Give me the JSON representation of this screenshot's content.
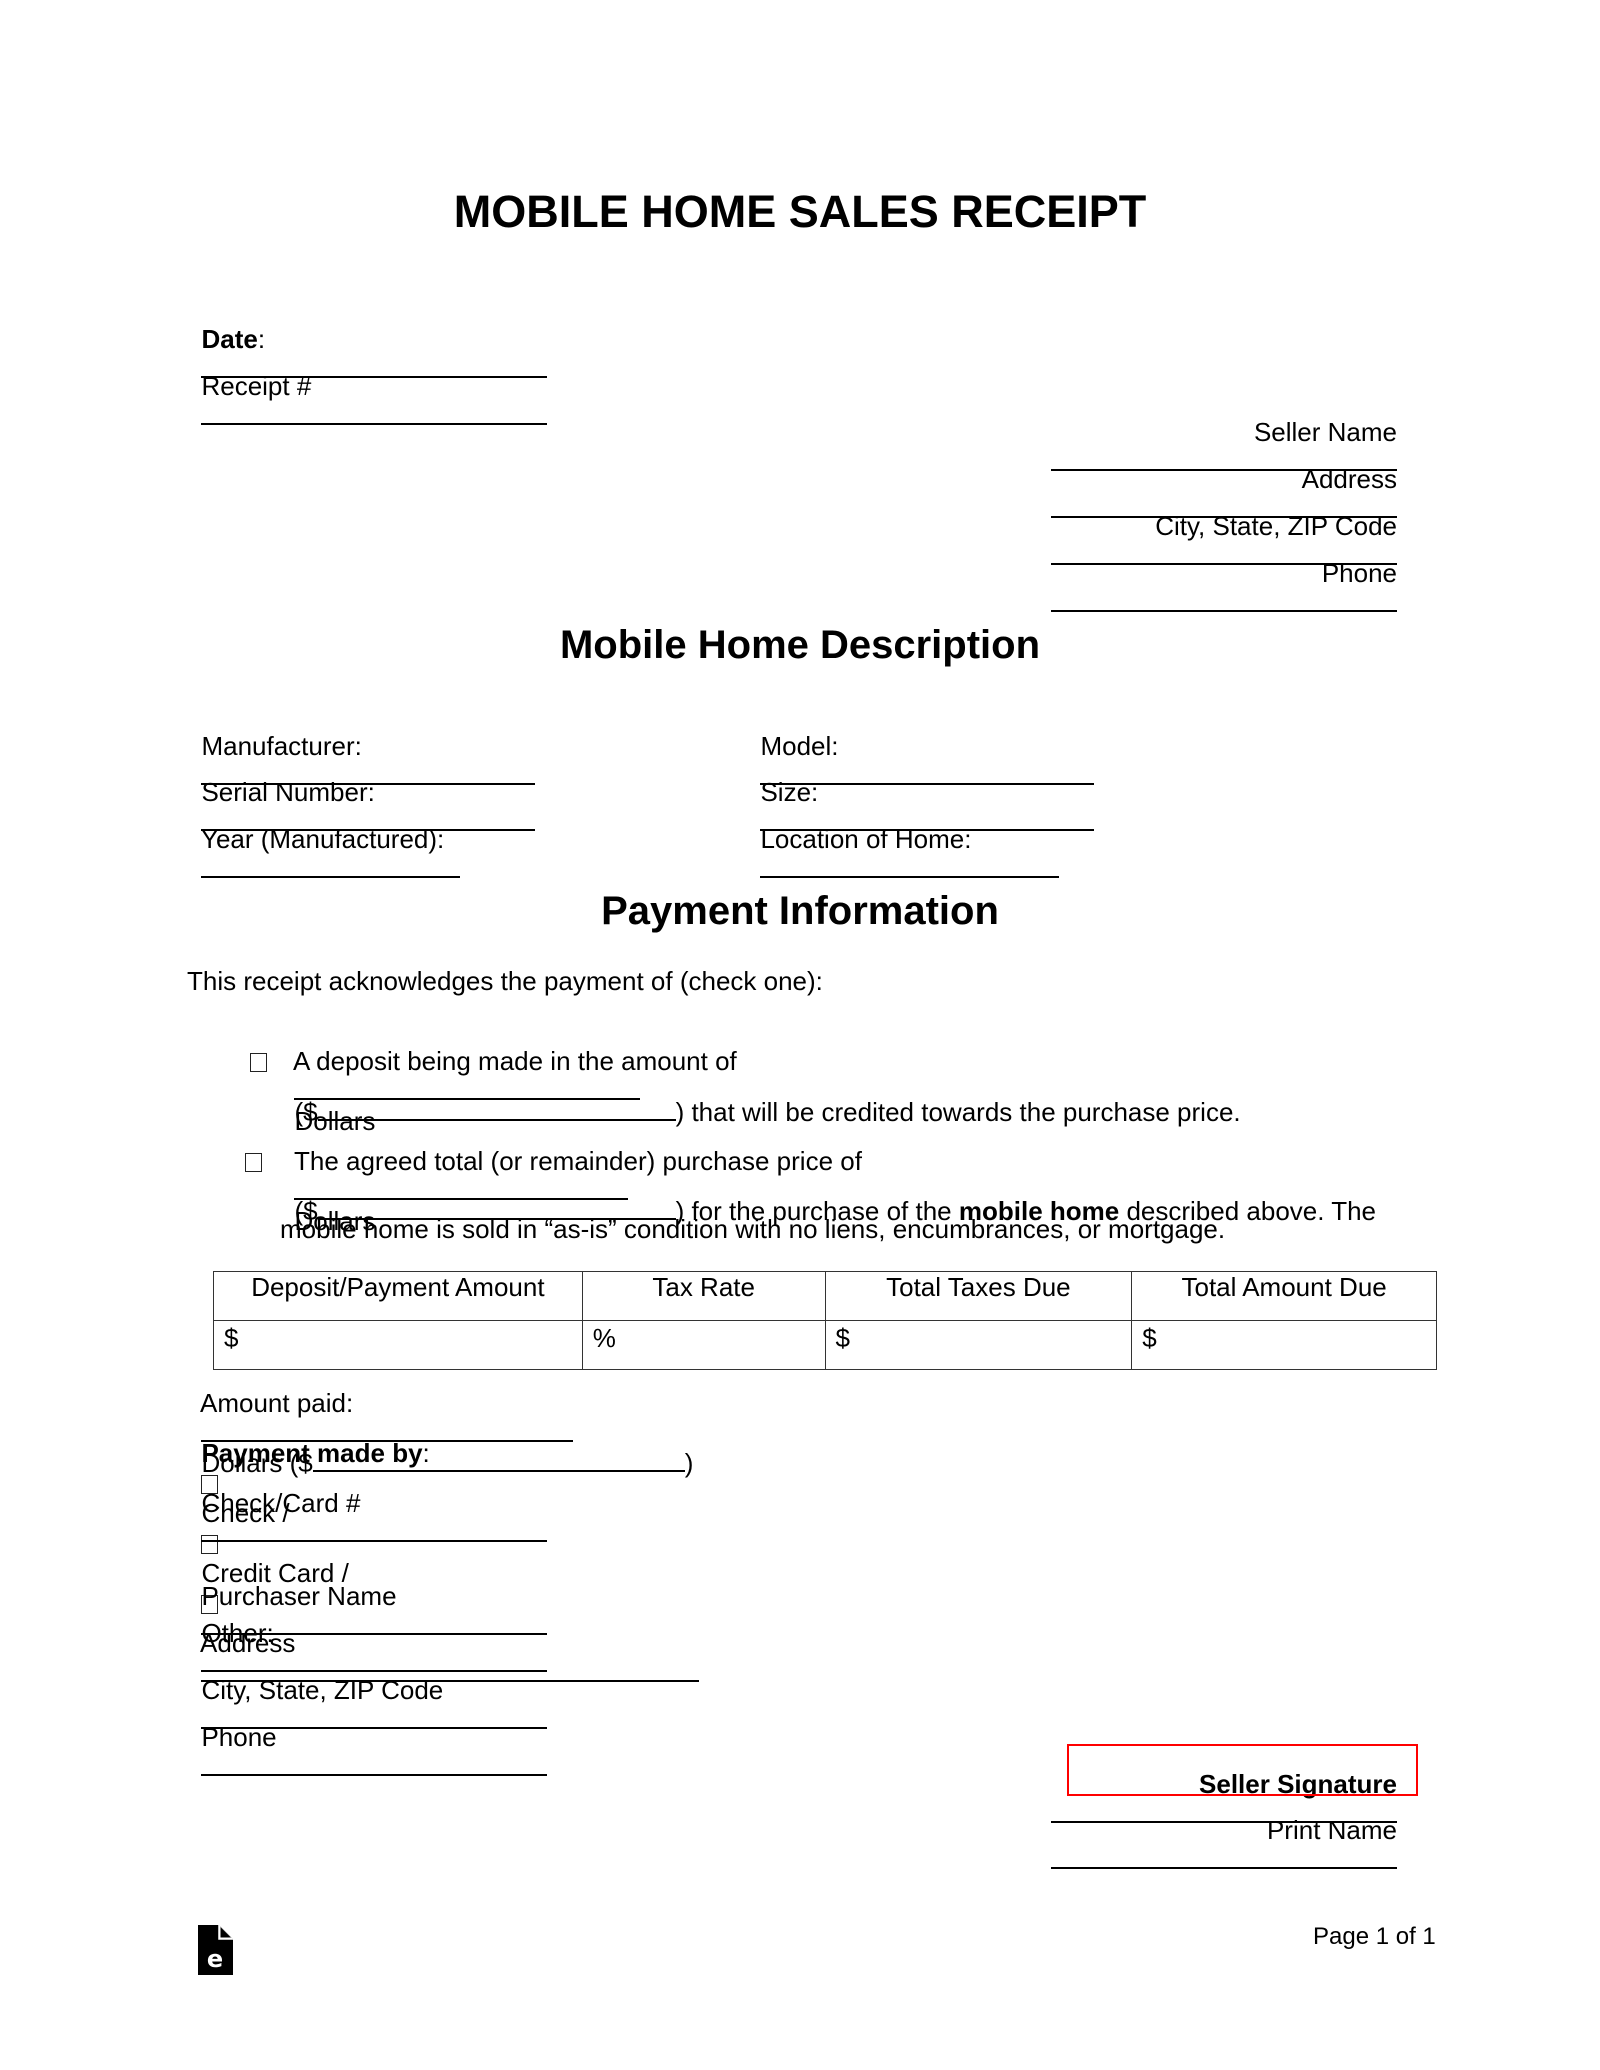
{
  "title": "MOBILE HOME SALES RECEIPT",
  "header": {
    "date_label": "Date",
    "date_colon": ":",
    "receipt_label": "Receipt #"
  },
  "seller": {
    "name_label": "Seller Name",
    "address_label": "Address",
    "city_label": "City, State, ZIP Code",
    "phone_label": "Phone"
  },
  "description": {
    "heading": "Mobile Home Description",
    "manufacturer_label": "Manufacturer:",
    "model_label": "Model:",
    "serial_label": "Serial Number:",
    "size_label": "Size:",
    "year_label": "Year (Manufactured):",
    "location_label": "Location of Home:"
  },
  "payment": {
    "heading": "Payment Information",
    "intro": "This receipt acknowledges the payment of (check one):",
    "option1": {
      "line1_prefix": "A deposit being made in the amount of",
      "line1_suffix": "Dollars",
      "line2_prefix": "($",
      "line2_suffix": ") that will be credited towards the purchase price."
    },
    "option2": {
      "line1_prefix": "The agreed total (or remainder) purchase price of",
      "line1_suffix": "Dollars",
      "line2_prefix": "($",
      "line2_mid": ") for the purchase of the ",
      "line2_bold": "mobile home",
      "line2_suffix": " described above. The",
      "line3": "mobile home is sold in “as-is” condition with no liens, encumbrances, or mortgage."
    },
    "table": {
      "headers": [
        "Deposit/Payment Amount",
        "Tax Rate",
        "Total Taxes Due",
        "Total Amount Due"
      ],
      "row": [
        "$",
        "%",
        "$",
        "$"
      ]
    },
    "amount_paid_label": "Amount paid:",
    "amount_paid_mid": "Dollars ($",
    "amount_paid_end": ")",
    "made_by_label": "Payment made by",
    "made_by_colon": ":",
    "check_label": "Check /",
    "credit_label": "Credit Card /",
    "other_label": "Other:",
    "check_card_label": "Check/Card #"
  },
  "purchaser": {
    "name_label": "Purchaser Name",
    "address_label": "Address",
    "city_label": "City, State, ZIP Code",
    "phone_label": "Phone"
  },
  "signature": {
    "seller_signature_label": "Seller Signature",
    "print_name_label": "Print Name",
    "highlight_color": "#ff0000"
  },
  "footer": {
    "logo_icon": "eforms-document-icon",
    "page_label": "Page 1 of 1"
  }
}
